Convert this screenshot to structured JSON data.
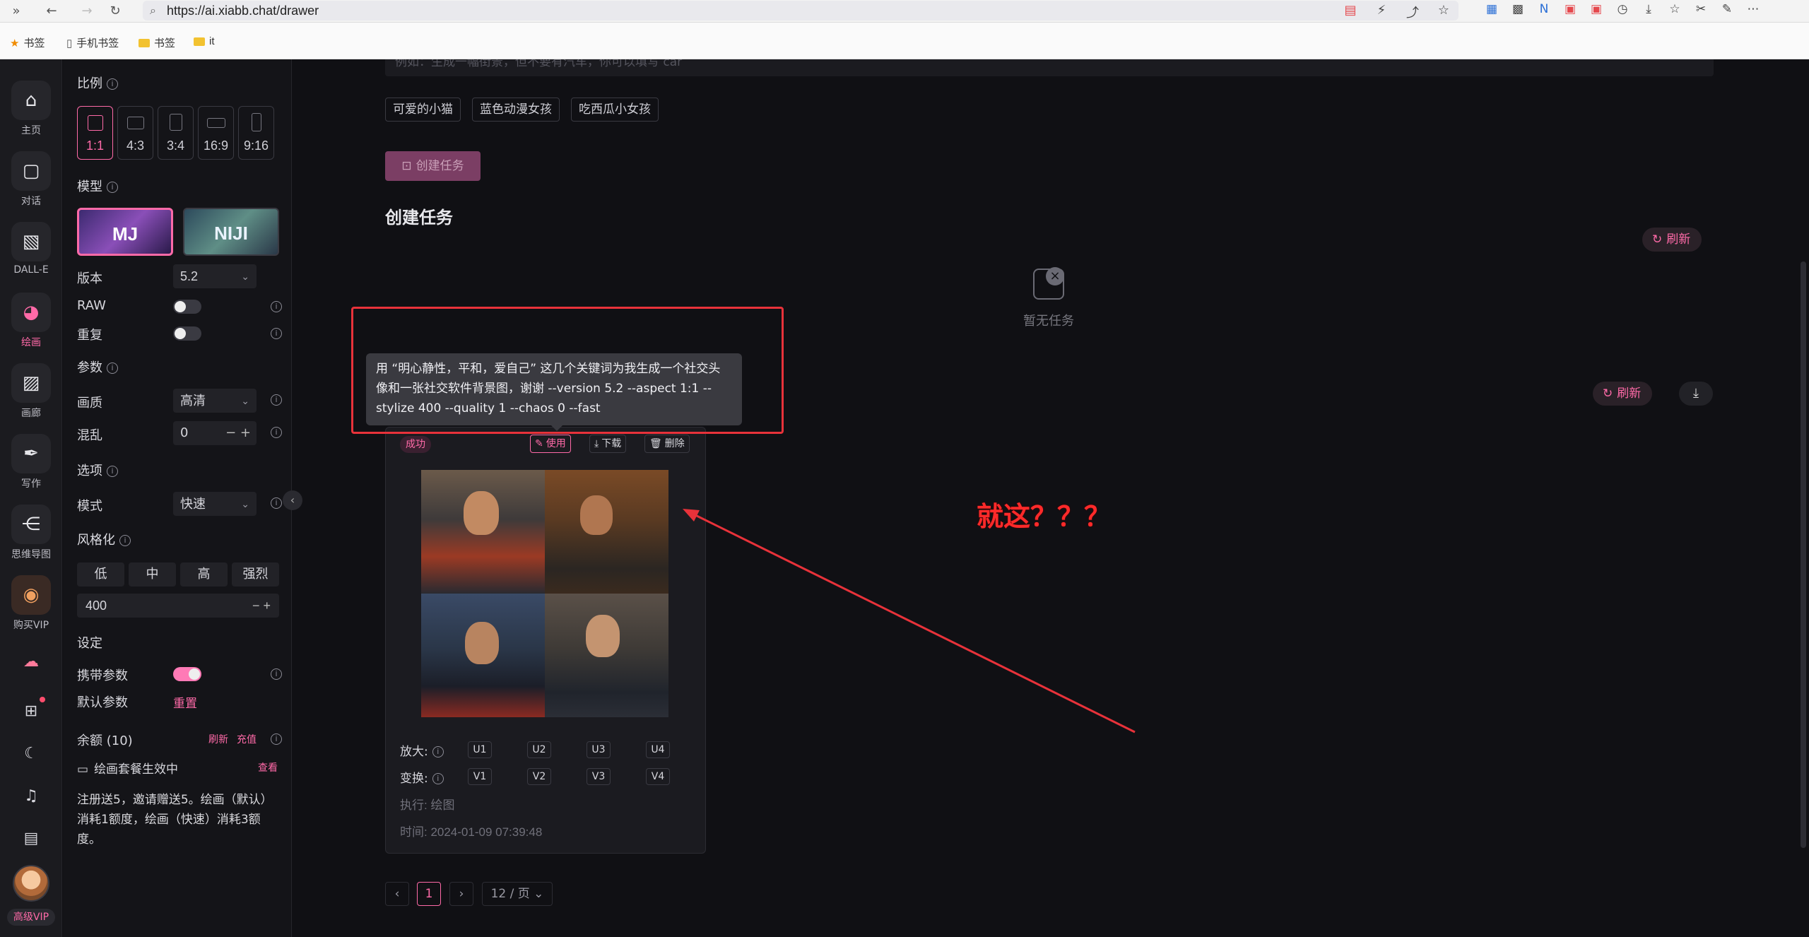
{
  "browser": {
    "url": "https://ai.xiabb.chat/drawer",
    "bookmarks": [
      "书签",
      "手机书签",
      "书签",
      "it"
    ]
  },
  "rail": {
    "items": [
      {
        "label": "主页",
        "icon": "home-icon"
      },
      {
        "label": "对话",
        "icon": "chat-icon"
      },
      {
        "label": "DALL-E",
        "icon": "image-icon"
      },
      {
        "label": "绘画",
        "icon": "palette-icon"
      },
      {
        "label": "画廊",
        "icon": "gallery-icon"
      },
      {
        "label": "写作",
        "icon": "pen-icon"
      },
      {
        "label": "思维导图",
        "icon": "mindmap-icon"
      },
      {
        "label": "购买VIP",
        "icon": "vip-icon"
      }
    ],
    "vip_badge": "高级VIP"
  },
  "settings": {
    "ratio_title": "比例",
    "ratios": [
      "1:1",
      "4:3",
      "3:4",
      "16:9",
      "9:16"
    ],
    "model_title": "模型",
    "models": [
      "MJ",
      "NIJI"
    ],
    "version_label": "版本",
    "version_value": "5.2",
    "raw_label": "RAW",
    "repeat_label": "重复",
    "params_title": "参数",
    "quality_label": "画质",
    "quality_value": "高清",
    "chaos_label": "混乱",
    "chaos_value": "0",
    "options_title": "选项",
    "mode_label": "模式",
    "mode_value": "快速",
    "stylize_title": "风格化",
    "stylize_levels": [
      "低",
      "中",
      "高",
      "强烈"
    ],
    "stylize_value": "400",
    "setup_title": "设定",
    "carry_params_label": "携带参数",
    "default_params_label": "默认参数",
    "reset_label": "重置",
    "balance_label": "余额 (10)",
    "refresh_label": "刷新",
    "recharge_label": "充值",
    "package_label": "绘画套餐生效中",
    "view_label": "查看",
    "note": "注册送5，邀请赠送5。绘画（默认）消耗1额度，绘画（快速）消耗3额度。"
  },
  "main": {
    "prompt_placeholder": "例如：生成一幅街景，但不要有汽车，你可以填写 car",
    "chips": [
      "可爱的小猫",
      "蓝色动漫女孩",
      "吃西瓜小女孩"
    ],
    "create_button": "创建任务",
    "section_title": "创建任务",
    "refresh_label": "刷新",
    "empty_text": "暂无任务",
    "tooltip": "用 “明心静性，平和，爱自己” 这几个关键词为我生成一个社交头像和一张社交软件背景图，谢谢 --version 5.2 --aspect 1:1 --stylize 400 --quality 1 --chaos 0 --fast",
    "annotation": "就这？？？"
  },
  "task": {
    "status": "成功",
    "use_label": "使用",
    "download_label": "下载",
    "delete_label": "删除",
    "upscale_label": "放大:",
    "upscale_buttons": [
      "U1",
      "U2",
      "U3",
      "U4"
    ],
    "variation_label": "变换:",
    "variation_buttons": [
      "V1",
      "V2",
      "V3",
      "V4"
    ],
    "exec_text": "执行: 绘图",
    "time_text": "时间: 2024-01-09 07:39:48"
  },
  "pagination": {
    "current": "1",
    "page_size": "12 / 页"
  },
  "colors": {
    "accent": "#ff6aa8",
    "annotation_red": "#e8323a",
    "background": "#101014"
  }
}
